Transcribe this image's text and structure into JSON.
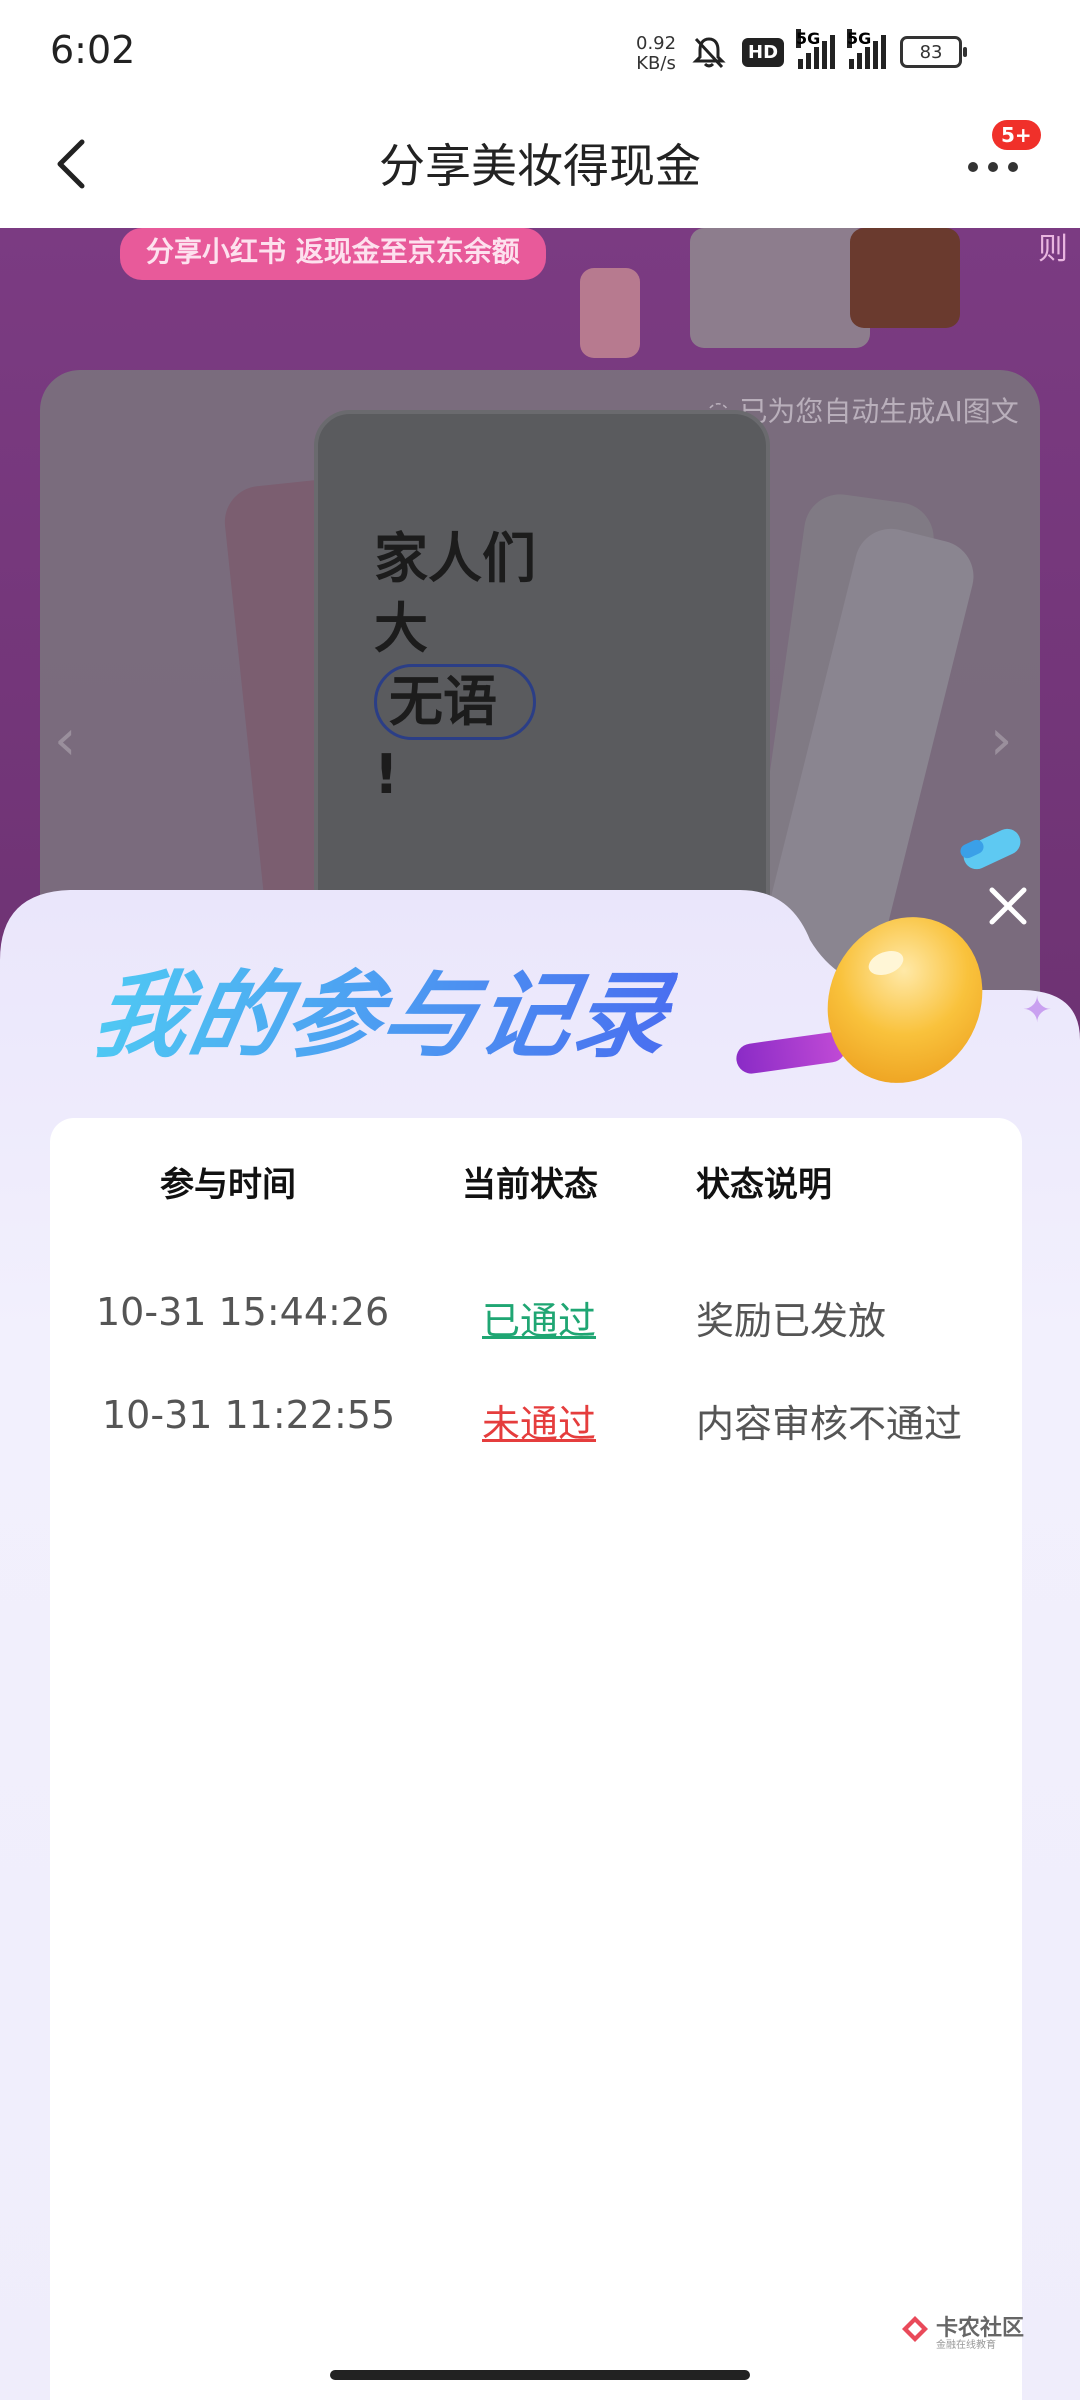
{
  "status_bar": {
    "time": "6:02",
    "net_speed_value": "0.92",
    "net_speed_unit": "KB/s",
    "hd_label": "HD",
    "signal1_label": "5G",
    "signal2_label": "5G",
    "battery": "83"
  },
  "nav": {
    "title": "分享美妆得现金",
    "badge": "5+"
  },
  "background": {
    "promo_text": "分享小红书 返现金至京东余额",
    "rule_text": "则",
    "ai_tag": "已为您自动生成AI图文",
    "card_lines": [
      "家人们",
      "大",
      "无语",
      "!"
    ]
  },
  "modal": {
    "title": "我的参与记录",
    "headers": [
      "参与时间",
      "当前状态",
      "状态说明"
    ],
    "rows": [
      {
        "time": "10-31 15:44:26",
        "status": "已通过",
        "note": "奖励已发放"
      },
      {
        "time": "10-31 11:22:55",
        "status": "未通过",
        "note": "内容审核不通过"
      }
    ]
  },
  "watermark": {
    "name": "卡农社区",
    "sub": "金融在线教育"
  },
  "colors": {
    "pass": "#1fa673",
    "fail": "#e53d3d",
    "title_gradient_start": "#4fc9f3",
    "title_gradient_end": "#4a6ff0",
    "badge": "#f0302a"
  },
  "icons": [
    "back-arrow-icon",
    "more-dots-icon",
    "close-icon",
    "mute-bell-icon",
    "signal-icon",
    "battery-icon",
    "check-circle-icon",
    "chevron-left-icon",
    "chevron-right-icon"
  ]
}
